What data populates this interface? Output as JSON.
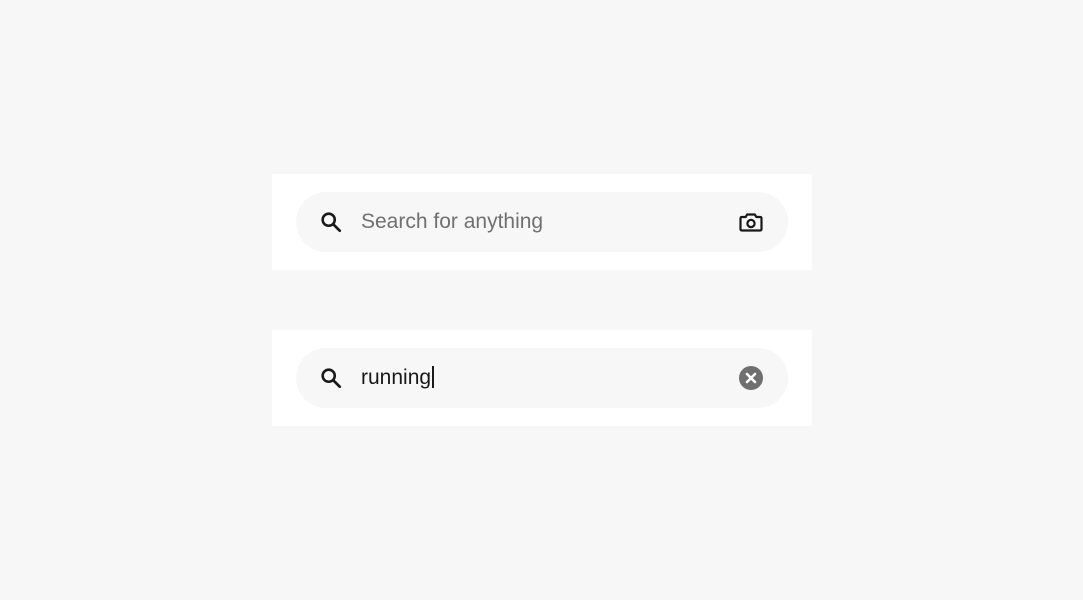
{
  "search_default": {
    "placeholder": "Search for anything",
    "leading_icon": "search-icon",
    "trailing_icon": "camera-icon"
  },
  "search_active": {
    "value": "running",
    "leading_icon": "search-icon",
    "trailing_icon": "clear-icon"
  },
  "colors": {
    "page_background": "#f7f7f7",
    "card_background": "#ffffff",
    "field_background": "#f7f7f7",
    "placeholder_text": "#707070",
    "input_text": "#191919",
    "clear_icon": "#707070"
  }
}
